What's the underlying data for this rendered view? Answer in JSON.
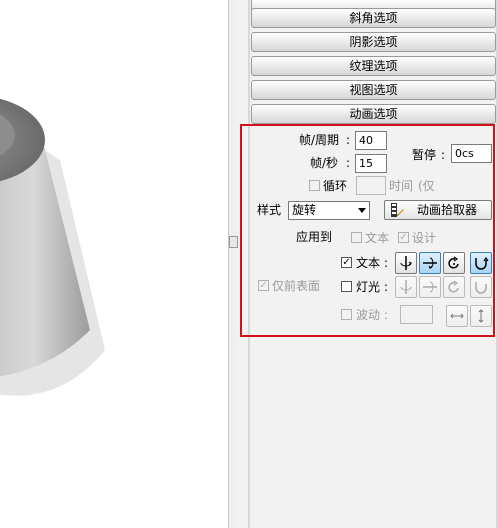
{
  "accordion": {
    "bevel": "斜角选项",
    "shadow": "阴影选项",
    "texture": "纹理选项",
    "view": "视图选项",
    "animation": "动画选项"
  },
  "animation": {
    "frames_per_cycle_label": "帧/周期",
    "frames_per_cycle_value": "40",
    "fps_label": "帧/秒",
    "fps_value": "15",
    "pause_label": "暂停",
    "pause_value": "0cs",
    "loop_label": "循环",
    "time_label": "时间",
    "only_label": "(仅",
    "style_label": "样式",
    "style_value": "旋转",
    "picker_label": "动画拾取器",
    "apply_to_label": "应用到",
    "apply_text_label": "文本",
    "apply_design_label": "设计",
    "front_surface_label": "仅前表面",
    "text_label": "文本",
    "light_label": "灯光",
    "wave_label": "波动",
    "colon": ":"
  }
}
